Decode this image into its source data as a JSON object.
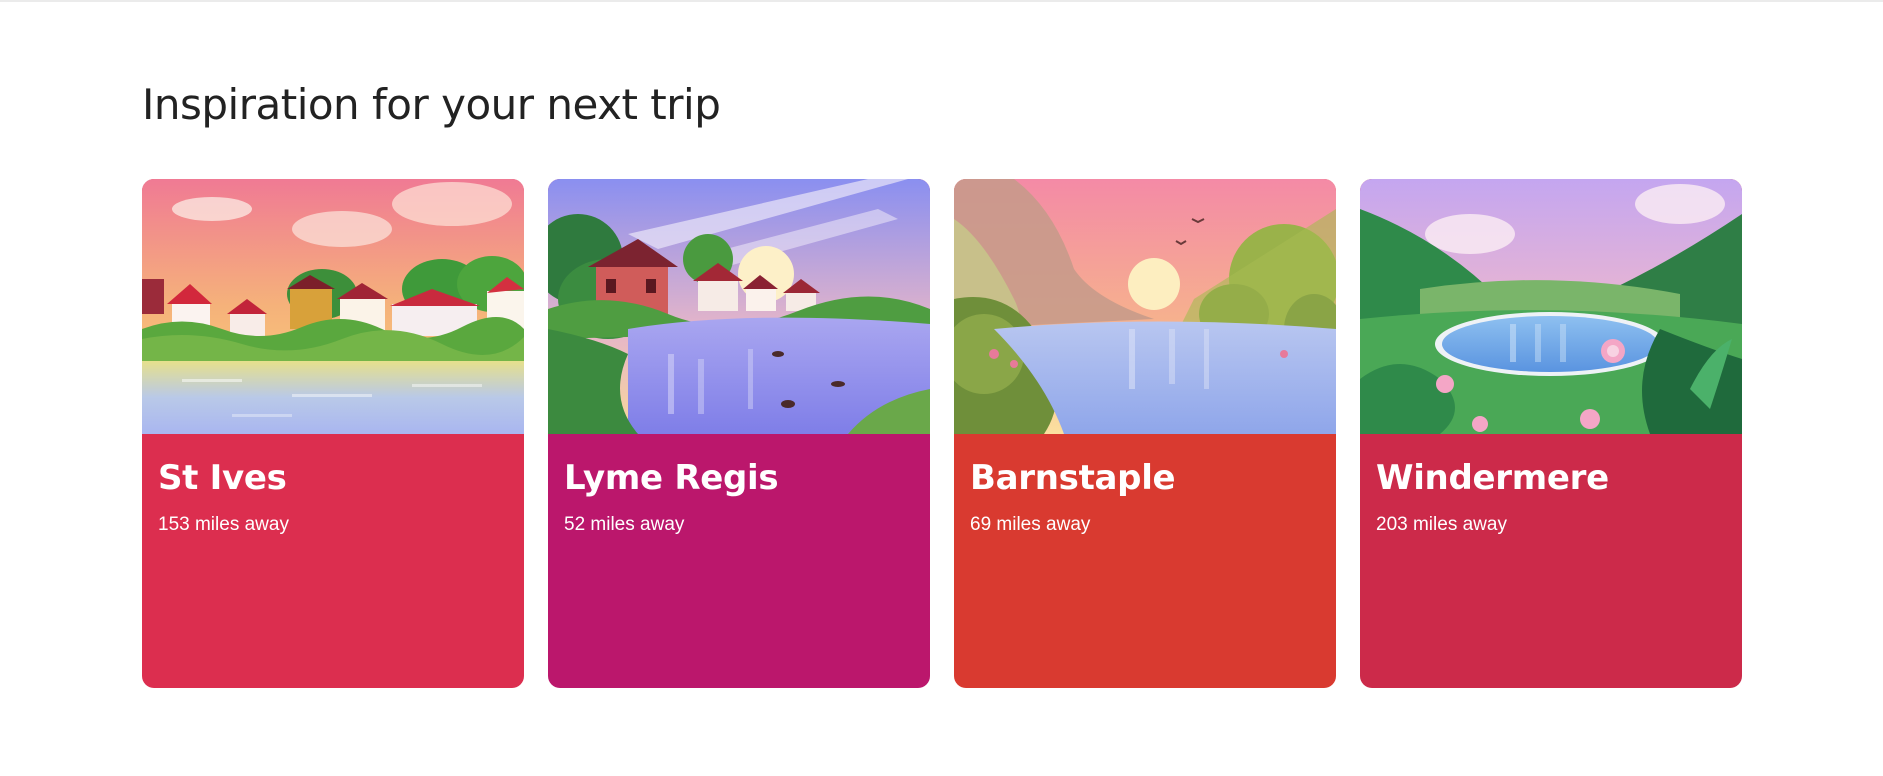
{
  "section": {
    "title": "Inspiration for your next trip"
  },
  "cards": [
    {
      "name": "St Ives",
      "distance": "153 miles away",
      "color": "#dc2e4f"
    },
    {
      "name": "Lyme Regis",
      "distance": "52 miles away",
      "color": "#bb176c"
    },
    {
      "name": "Barnstaple",
      "distance": "69 miles away",
      "color": "#d93a30"
    },
    {
      "name": "Windermere",
      "distance": "203 miles away",
      "color": "#cc2a4a"
    }
  ]
}
